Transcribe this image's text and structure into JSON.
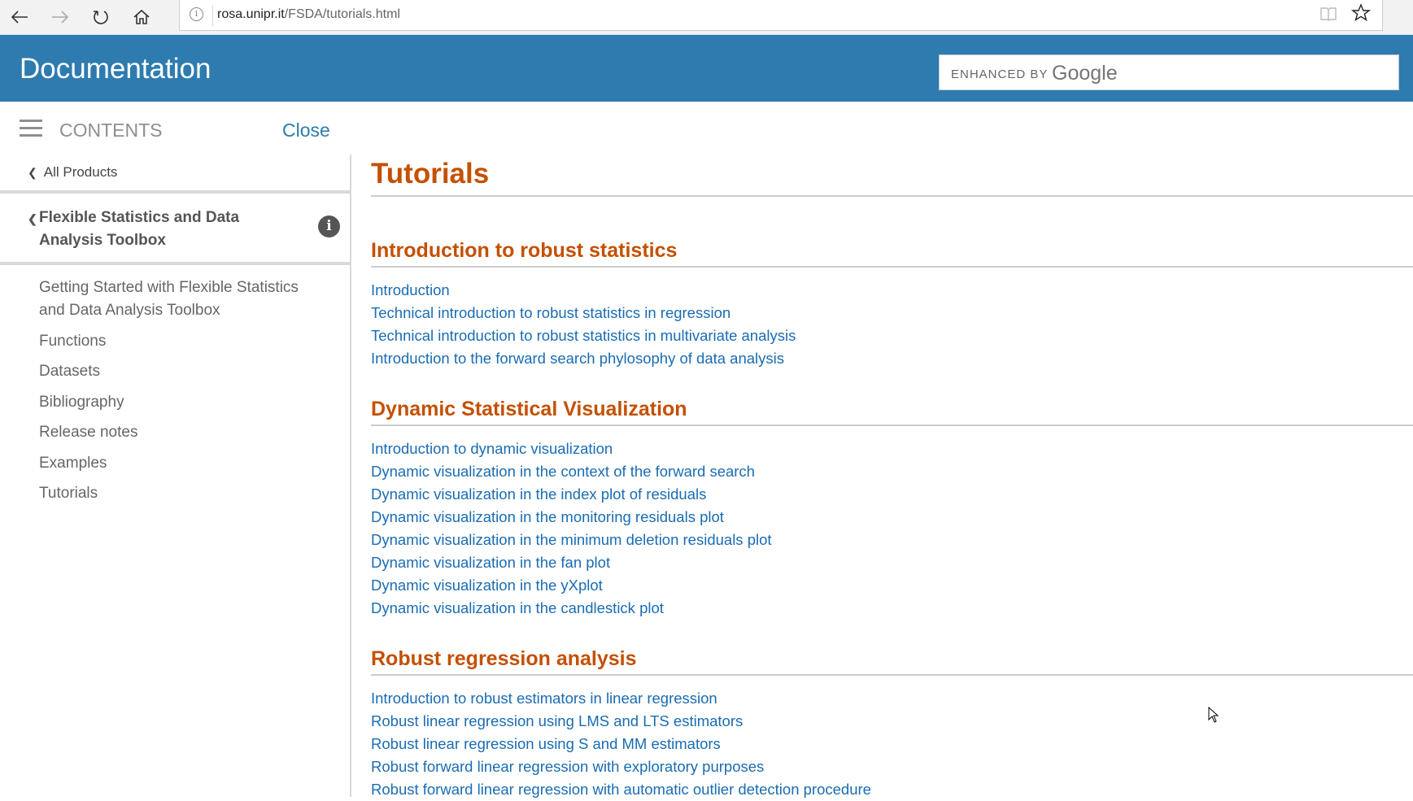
{
  "browser": {
    "back_icon": "arrow-left-icon",
    "forward_icon": "arrow-right-icon",
    "refresh_icon": "refresh-icon",
    "home_icon": "home-icon",
    "url_host": "rosa.unipr.it",
    "url_path": "/FSDA/tutorials.html",
    "info_glyph": "i",
    "reader_icon": "reading-view-icon",
    "star_icon": "favorite-star-icon"
  },
  "header": {
    "title": "Documentation",
    "search": {
      "enhanced_by": "ENHANCED BY",
      "brand": "Google"
    }
  },
  "contents_bar": {
    "label": "CONTENTS",
    "close": "Close"
  },
  "sidebar": {
    "all_products": "All Products",
    "toolbox_title": "Flexible Statistics and Data Analysis Toolbox",
    "items": [
      {
        "label": "Getting Started with Flexible Statistics and Data Analysis Toolbox"
      },
      {
        "label": "Functions"
      },
      {
        "label": "Datasets"
      },
      {
        "label": "Bibliography"
      },
      {
        "label": "Release notes"
      },
      {
        "label": "Examples"
      },
      {
        "label": "Tutorials"
      }
    ]
  },
  "main": {
    "title": "Tutorials",
    "sections": [
      {
        "heading": "Introduction to robust statistics",
        "links": [
          "Introduction",
          "Technical introduction to robust statistics in regression",
          "Technical introduction to robust statistics in multivariate analysis",
          "Introduction to the forward search phylosophy of data analysis"
        ]
      },
      {
        "heading": "Dynamic Statistical Visualization",
        "links": [
          "Introduction to dynamic visualization",
          "Dynamic visualization in the context of the forward search",
          "Dynamic visualization in the index plot of residuals",
          "Dynamic visualization in the monitoring residuals plot",
          "Dynamic visualization in the minimum deletion residuals plot",
          "Dynamic visualization in the fan plot",
          "Dynamic visualization in the yXplot",
          "Dynamic visualization in the candlestick plot"
        ]
      },
      {
        "heading": "Robust regression analysis",
        "links": [
          "Introduction to robust estimators in linear regression",
          "Robust linear regression using LMS and LTS estimators",
          "Robust linear regression using S and MM estimators",
          "Robust forward linear regression with exploratory purposes",
          "Robust forward linear regression with automatic outlier detection procedure"
        ]
      }
    ]
  },
  "colors": {
    "header_blue": "#2e7bb0",
    "heading_orange": "#c45000",
    "link_blue": "#1a6cb3"
  }
}
